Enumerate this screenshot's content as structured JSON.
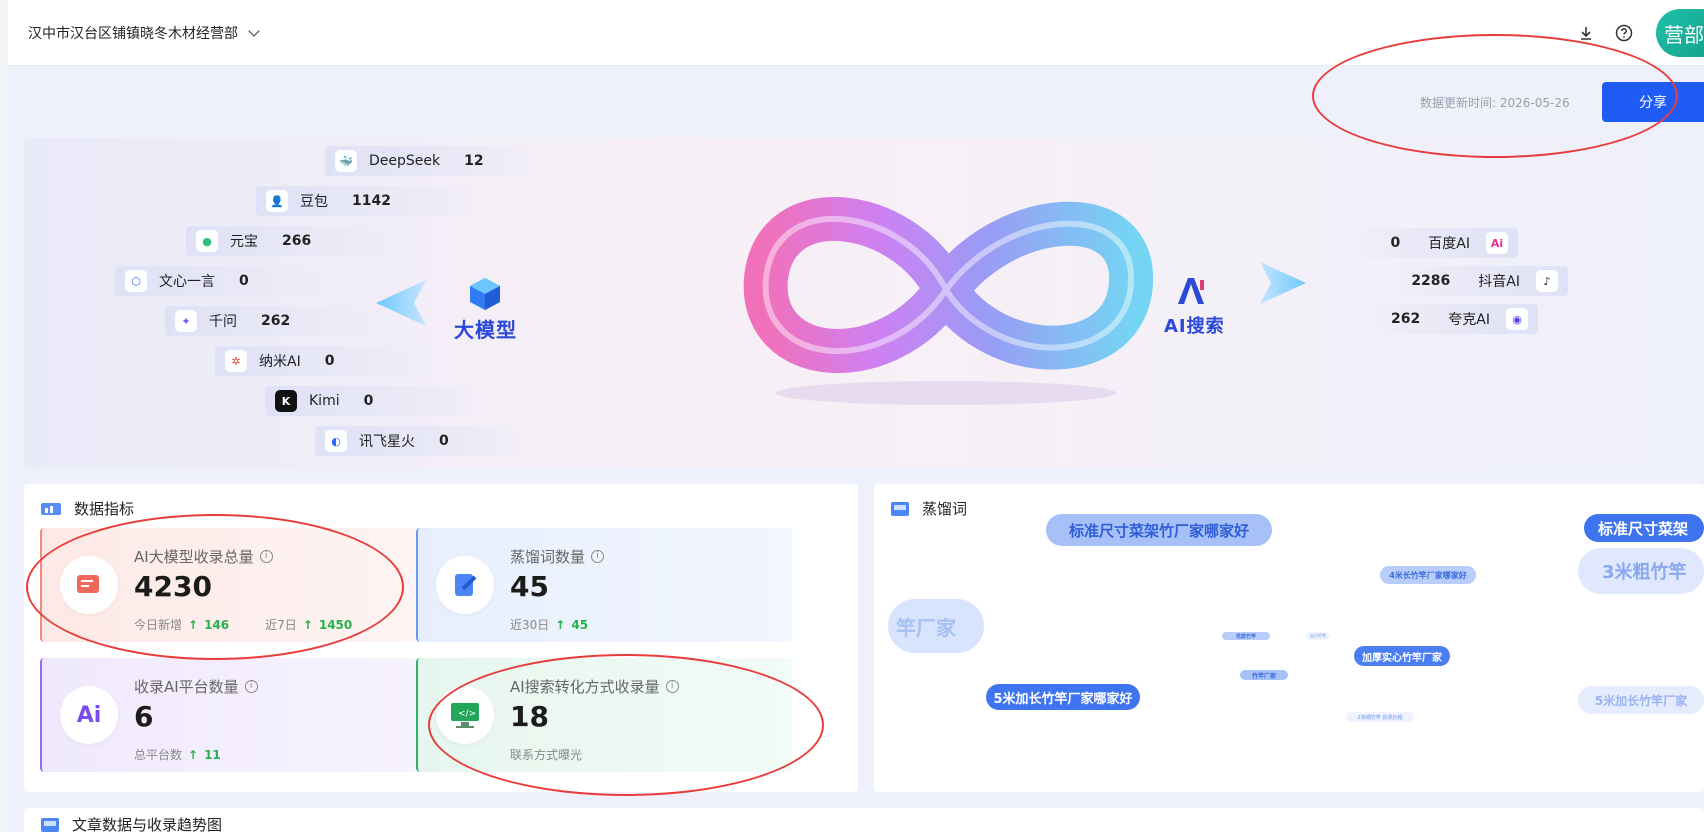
{
  "header": {
    "org_name": "汉中市汉台区铺镇晓冬木材经营部",
    "avatar_text": "营部"
  },
  "update_text": "数据更新时间: 2026-05-26",
  "share_label": "分享",
  "hero": {
    "left_label": "大模型",
    "right_label": "AI搜索",
    "models": [
      {
        "name": "DeepSeek",
        "value": "12"
      },
      {
        "name": "豆包",
        "value": "1142"
      },
      {
        "name": "元宝",
        "value": "266"
      },
      {
        "name": "文心一言",
        "value": "0"
      },
      {
        "name": "千问",
        "value": "262"
      },
      {
        "name": "纳米AI",
        "value": "0"
      },
      {
        "name": "Kimi",
        "value": "0"
      },
      {
        "name": "讯飞星火",
        "value": "0"
      }
    ],
    "search": [
      {
        "name": "百度AI",
        "value": "0"
      },
      {
        "name": "抖音AI",
        "value": "2286"
      },
      {
        "name": "夸克AI",
        "value": "262"
      }
    ]
  },
  "metrics": {
    "title": "数据指标",
    "cards": [
      {
        "title": "AI大模型收录总量",
        "value": "4230",
        "sub1_label": "今日新增",
        "sub1_value": "146",
        "sub2_label": "近7日",
        "sub2_value": "1450"
      },
      {
        "title": "蒸馏词数量",
        "value": "45",
        "sub1_label": "近30日",
        "sub1_value": "45"
      },
      {
        "title": "收录AI平台数量",
        "value": "6",
        "sub1_label": "总平台数",
        "sub1_value": "11"
      },
      {
        "title": "AI搜索转化方式收录量",
        "value": "18",
        "sub1_label": "联系方式曝光"
      }
    ]
  },
  "cloud": {
    "title": "蒸馏词",
    "tags": [
      "标准尺寸菜架竹厂家哪家好",
      "标准尺寸菜架",
      "3米粗竹竿",
      "4米长竹竿厂家哪家好",
      "竿厂家",
      "加厚实心竹竿厂家",
      "5米加长竹竿厂家哪家好",
      "5米加长竹竿厂家",
      "竹竿厂家",
      "优质竹竿",
      "出口竹竿",
      "2米细竹竿 批发价格"
    ]
  },
  "trend": {
    "title": "文章数据与收录趋势图"
  }
}
